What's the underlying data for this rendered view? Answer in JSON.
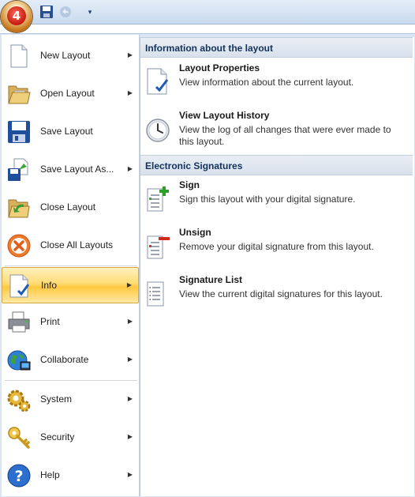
{
  "app": {
    "orb_label": "4"
  },
  "quick_access": {
    "save": "save-icon",
    "undo": "undo-icon",
    "more": "▾"
  },
  "menu_items": [
    {
      "label": "New Layout",
      "icon": "new-document-icon",
      "has_submenu": true
    },
    {
      "label": "Open Layout",
      "icon": "open-folder-icon",
      "has_submenu": true
    },
    {
      "label": "Save Layout",
      "icon": "save-icon",
      "has_submenu": false
    },
    {
      "label": "Save Layout As...",
      "icon": "save-as-icon",
      "has_submenu": true
    },
    {
      "label": "Close Layout",
      "icon": "close-layout-icon",
      "has_submenu": false
    },
    {
      "label": "Close All Layouts",
      "icon": "close-all-icon",
      "has_submenu": false
    },
    {
      "label": "Info",
      "icon": "info-document-icon",
      "has_submenu": true,
      "selected": true
    },
    {
      "label": "Print",
      "icon": "printer-icon",
      "has_submenu": true
    },
    {
      "label": "Collaborate",
      "icon": "globe-icon",
      "has_submenu": true
    },
    {
      "label": "System",
      "icon": "gears-icon",
      "has_submenu": true
    },
    {
      "label": "Security",
      "icon": "key-icon",
      "has_submenu": true
    },
    {
      "label": "Help",
      "icon": "help-icon",
      "has_submenu": true
    }
  ],
  "submenu_arrow": "▶",
  "panel": {
    "sections": [
      {
        "title": "Information about the layout",
        "items": [
          {
            "title": "Layout Properties",
            "desc": "View information about the current layout.",
            "icon": "properties-icon"
          },
          {
            "title": "View Layout History",
            "desc": "View the log of all changes that were ever made to this layout.",
            "icon": "clock-icon"
          }
        ]
      },
      {
        "title": "Electronic Signatures",
        "items": [
          {
            "title": "Sign",
            "desc": "Sign this layout with your digital signature.",
            "icon": "sign-icon"
          },
          {
            "title": "Unsign",
            "desc": "Remove your digital signature from this layout.",
            "icon": "unsign-icon"
          },
          {
            "title": "Signature List",
            "desc": "View the current digital signatures for this layout.",
            "icon": "signature-list-icon"
          }
        ]
      }
    ]
  }
}
